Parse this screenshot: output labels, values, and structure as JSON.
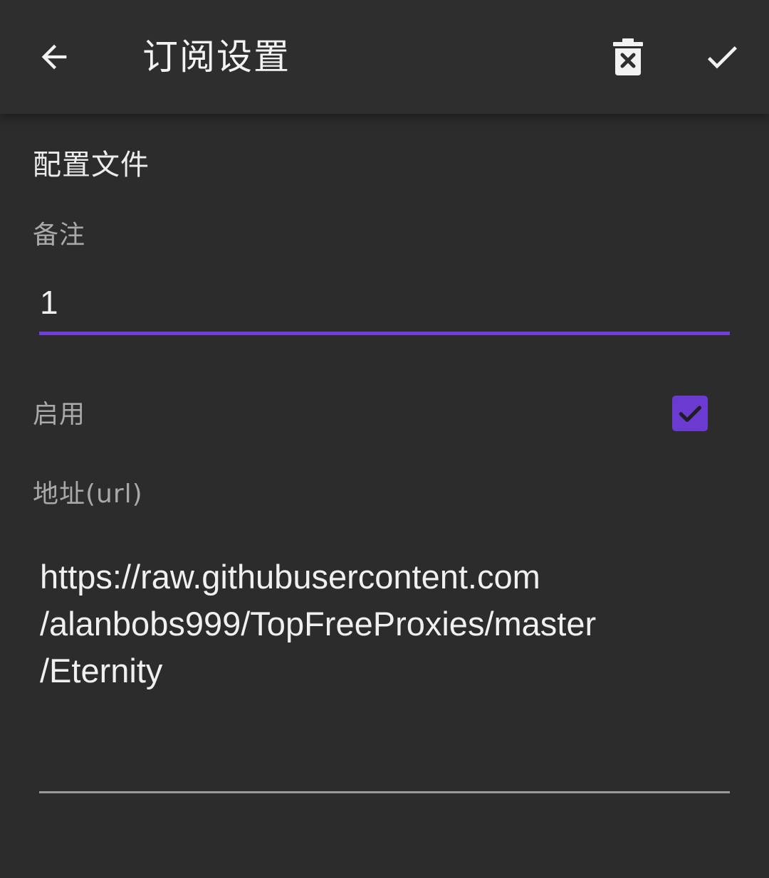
{
  "toolbar": {
    "title": "订阅设置",
    "back_icon": "arrow-left-icon",
    "delete_icon": "delete-icon",
    "save_icon": "check-icon"
  },
  "section": {
    "title": "配置文件"
  },
  "remark": {
    "label": "备注",
    "value": "1"
  },
  "enable": {
    "label": "启用",
    "checked": true
  },
  "url": {
    "label": "地址(url)",
    "value": "https://raw.githubusercontent.com\n/alanbobs999/TopFreeProxies/master\n/Eternity"
  },
  "colors": {
    "background": "#2c2c2c",
    "accent": "#6a3ad1",
    "text": "#f0f0f0",
    "label": "#a9a9a9"
  }
}
